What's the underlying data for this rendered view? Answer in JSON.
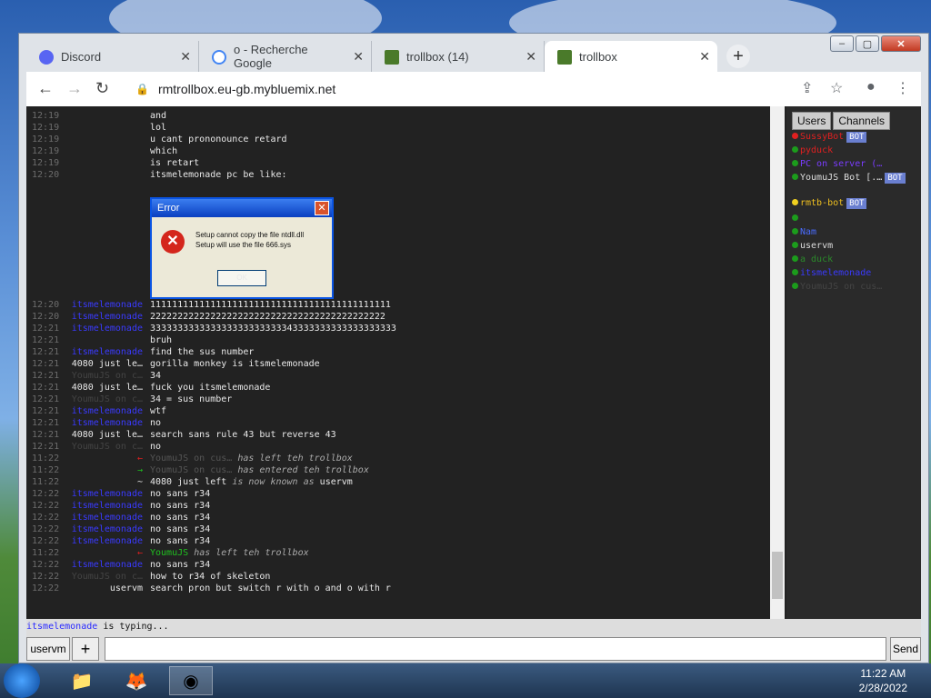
{
  "browser": {
    "tabs": [
      {
        "label": "Discord",
        "icon": "discord-icon",
        "color": "#5865f2"
      },
      {
        "label": "o - Recherche Google",
        "icon": "google-icon",
        "color": "#4285f4"
      },
      {
        "label": "trollbox (14)",
        "icon": "trollbox-icon",
        "color": "#4a7a2a"
      },
      {
        "label": "trollbox",
        "icon": "trollbox-icon",
        "color": "#4a7a2a",
        "active": true
      }
    ],
    "url": "rmtrollbox.eu-gb.mybluemix.net"
  },
  "chat": {
    "lines": [
      {
        "time": "12:19",
        "nick": "",
        "msg": "and"
      },
      {
        "time": "12:19",
        "nick": "",
        "msg": "lol"
      },
      {
        "time": "12:19",
        "nick": "",
        "msg": "u cant prononounce retard"
      },
      {
        "time": "12:19",
        "nick": "",
        "msg": "which"
      },
      {
        "time": "12:19",
        "nick": "",
        "msg": "is retart"
      },
      {
        "time": "12:20",
        "nick": "",
        "msg": "itsmelemonade pc be like:"
      },
      {
        "time": "12:20",
        "nick": "itsmelemonade",
        "msg": "11111111111111111111111111111111111111111111"
      },
      {
        "time": "12:20",
        "nick": "itsmelemonade",
        "msg": "2222222222222222222222222222222222222222222"
      },
      {
        "time": "12:21",
        "nick": "itsmelemonade",
        "msg": "333333333333333333333333343333333333333333333"
      },
      {
        "time": "12:21",
        "nick": "",
        "msg": "bruh"
      },
      {
        "time": "12:21",
        "nick": "itsmelemonade",
        "msg": "find the sus number"
      },
      {
        "time": "12:21",
        "nick": "4080 just le…",
        "msg": "gorilla monkey is itsmelemonade"
      },
      {
        "time": "12:21",
        "nick": "YoumuJS on c…",
        "msg": "34"
      },
      {
        "time": "12:21",
        "nick": "4080 just le…",
        "msg": "fuck you itsmelemonade"
      },
      {
        "time": "12:21",
        "nick": "YoumuJS on c…",
        "msg": "34 = sus number"
      },
      {
        "time": "12:21",
        "nick": "itsmelemonade",
        "msg": "wtf"
      },
      {
        "time": "12:21",
        "nick": "itsmelemonade",
        "msg": "no"
      },
      {
        "time": "12:21",
        "nick": "4080 just le…",
        "msg": "search sans rule 43 but reverse 43"
      },
      {
        "time": "12:21",
        "nick": "YoumuJS on c…",
        "msg": "no"
      },
      {
        "time": "11:22",
        "nick": "←",
        "who": "YoumuJS on cus…",
        "sys": "has left teh trollbox"
      },
      {
        "time": "11:22",
        "nick": "→",
        "who": "YoumuJS on cus…",
        "sys": "has entered teh trollbox"
      },
      {
        "time": "11:22",
        "nick": "~",
        "who": "4080 just left",
        "sys": "is now known as",
        "after": "uservm"
      },
      {
        "time": "12:22",
        "nick": "itsmelemonade",
        "msg": "no sans r34"
      },
      {
        "time": "12:22",
        "nick": "itsmelemonade",
        "msg": "no sans r34"
      },
      {
        "time": "12:22",
        "nick": "itsmelemonade",
        "msg": "no sans r34"
      },
      {
        "time": "12:22",
        "nick": "itsmelemonade",
        "msg": "no sans r34"
      },
      {
        "time": "12:22",
        "nick": "itsmelemonade",
        "msg": "no sans r34"
      },
      {
        "time": "11:22",
        "nick": "←",
        "who": "YoumuJS",
        "sys": "has left teh trollbox"
      },
      {
        "time": "12:22",
        "nick": "itsmelemonade",
        "msg": "no sans r34"
      },
      {
        "time": "12:22",
        "nick": "YoumuJS on c…",
        "msg": "how to r34 of skeleton"
      },
      {
        "time": "12:22",
        "nick": "uservm",
        "msg": "search pron but switch r with o and o with r"
      }
    ],
    "error_dialog": {
      "title": "Error",
      "line1": "Setup cannot copy the file ntdll.dll",
      "line2": "Setup will use the file 666.sys",
      "ok": "OK"
    },
    "typing": "itsmelemonade",
    "typing_suffix": "is typing...",
    "nick_button": "uservm",
    "add_button": "+",
    "send": "Send"
  },
  "sidebar": {
    "tabs": [
      "Users",
      "Channels"
    ],
    "users": [
      {
        "name": "SussyBot",
        "color": "#e02020",
        "bot": true
      },
      {
        "name": "pyduck",
        "color": "#e02020"
      },
      {
        "name": "PC on server (…",
        "color": "#7a3cff"
      },
      {
        "name": "YoumuJS Bot [.…",
        "color": "#dddddd",
        "bot": true
      },
      {
        "name": "rmtb-bot",
        "color": "#f0c020",
        "bot": true
      },
      {
        "name": "",
        "color": "#dddddd"
      },
      {
        "name": "Nam",
        "color": "#4a6cff"
      },
      {
        "name": "uservm",
        "color": "#dddddd"
      },
      {
        "name": "a duck",
        "color": "#2a8a2a"
      },
      {
        "name": "itsmelemonade",
        "color": "#3a3aff"
      },
      {
        "name": "YoumuJS on cus…",
        "color": "#444444"
      }
    ],
    "bot_label": "BOT"
  },
  "taskbar": {
    "time": "11:22 AM",
    "date": "2/28/2022"
  }
}
